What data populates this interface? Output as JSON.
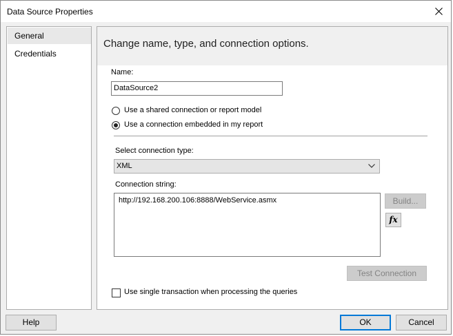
{
  "window": {
    "title": "Data Source Properties"
  },
  "nav": {
    "items": [
      {
        "label": "General",
        "selected": true
      },
      {
        "label": "Credentials",
        "selected": false
      }
    ]
  },
  "panel": {
    "header": "Change name, type, and connection options.",
    "name_label": "Name:",
    "name_value": "DataSource2",
    "radio_shared": "Use a shared connection or report model",
    "radio_embedded": "Use a connection embedded in my report",
    "selected_radio": "embedded",
    "conn_type_label": "Select connection type:",
    "conn_type_value": "XML",
    "conn_string_label": "Connection string:",
    "conn_string_value": "http://192.168.200.106:8888/WebService.asmx",
    "build_button": "Build...",
    "fx_button": "fx",
    "test_button": "Test Connection",
    "single_txn_label": "Use single transaction when processing the queries",
    "single_txn_checked": false
  },
  "footer": {
    "help": "Help",
    "ok": "OK",
    "cancel": "Cancel"
  }
}
